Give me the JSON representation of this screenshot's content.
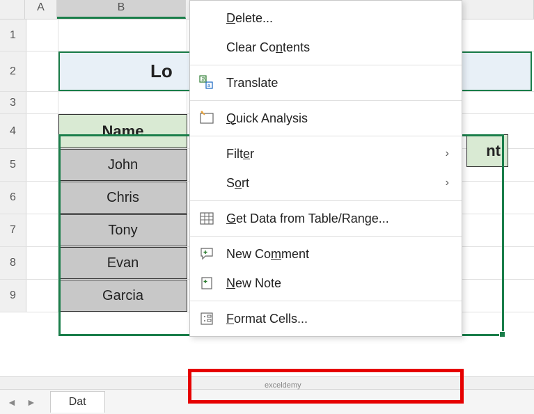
{
  "columns": {
    "A": "A",
    "B": "B"
  },
  "rows": [
    "1",
    "2",
    "3",
    "4",
    "5",
    "6",
    "7",
    "8",
    "9"
  ],
  "title_partial": "Lo",
  "table": {
    "header_left": "Name",
    "header_right_partial": "nt",
    "data": [
      "John",
      "Chris",
      "Tony",
      "Evan",
      "Garcia"
    ]
  },
  "context_menu": {
    "delete": "Delete...",
    "clear_contents": "Clear Contents",
    "translate": "Translate",
    "quick_analysis": "Quick Analysis",
    "filter": "Filter",
    "sort": "Sort",
    "get_data": "Get Data from Table/Range...",
    "new_comment": "New Comment",
    "new_note": "New Note",
    "format_cells": "Format Cells..."
  },
  "sheet_tab": "Dat",
  "watermark": "exceldemy"
}
